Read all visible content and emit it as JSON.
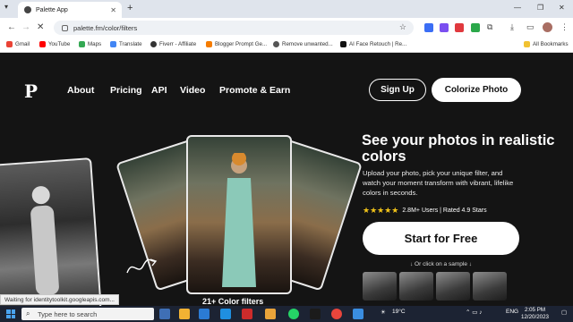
{
  "browser": {
    "tab_title": "Palette App",
    "url": "palette.fm/color/filters",
    "bookmarks": [
      "Gmail",
      "YouTube",
      "Maps",
      "Translate",
      "Fiverr - Affiliate",
      "Blogger Prompt Ge...",
      "Remove unwanted...",
      "AI Face Retouch | Re...",
      "All Bookmarks"
    ],
    "status_text": "Waiting for identitytoolkit.googleapis.com..."
  },
  "nav": {
    "logo": "P",
    "links": [
      "About",
      "Pricing",
      "API",
      "Video",
      "Promote & Earn"
    ],
    "signup": "Sign Up",
    "colorize": "Colorize Photo"
  },
  "hero": {
    "title": "See your photos in realistic colors",
    "subtitle": "Upload your photo, pick your unique filter, and watch your moment transform with vibrant, lifelike colors in seconds.",
    "rating": "2.8M+ Users | Rated 4.9 Stars",
    "cta": "Start for Free",
    "sample_prompt": "↓ Or click on a sample ↓",
    "filters_caption": "21+ Color filters"
  },
  "taskbar": {
    "search_placeholder": "Type here to search",
    "weather": "19°C",
    "language": "ENG",
    "time": "2:05 PM",
    "date": "12/20/2023"
  },
  "colors": {
    "page_bg": "#141414",
    "star": "#f2c419",
    "taskbar": "#1c2333"
  }
}
